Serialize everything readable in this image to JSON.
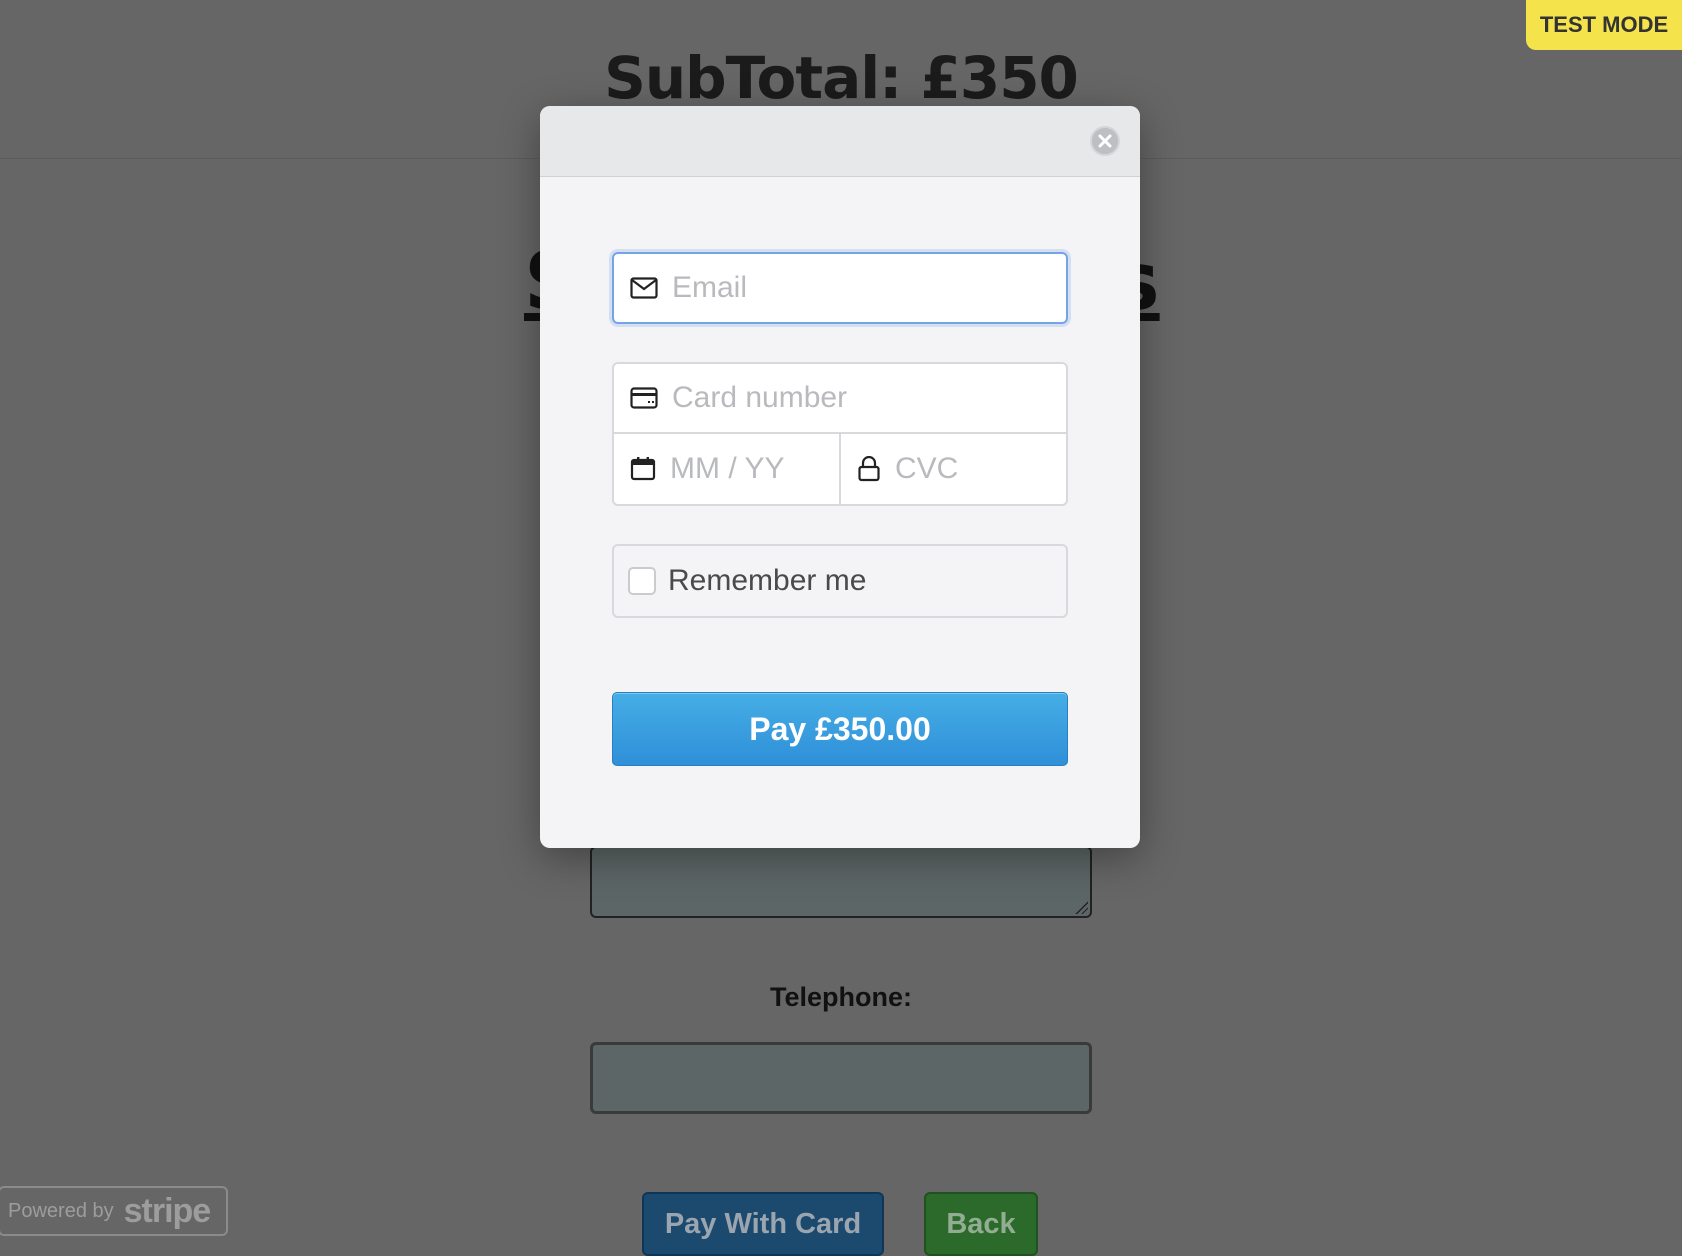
{
  "background": {
    "subtotal": "SubTotal: £350",
    "heading_left": "S",
    "heading_right": "s",
    "telephone_label": "Telephone:",
    "pay_with_card_label": "Pay With Card",
    "back_label": "Back"
  },
  "badges": {
    "test_mode": "TEST MODE",
    "powered_by_text": "Powered by",
    "powered_by_brand": "stripe"
  },
  "checkout_modal": {
    "email_placeholder": "Email",
    "card_number_placeholder": "Card number",
    "expiry_placeholder": "MM / YY",
    "cvc_placeholder": "CVC",
    "remember_label": "Remember me",
    "pay_button_label": "Pay £350.00",
    "icons": [
      "close-icon",
      "envelope-icon",
      "credit-card-icon",
      "calendar-icon",
      "lock-icon"
    ]
  },
  "colors": {
    "overlay": "#666666",
    "test_mode": "#f5e34c",
    "pay_button": "#3a9fe0",
    "focus_border": "#74a4e6"
  }
}
